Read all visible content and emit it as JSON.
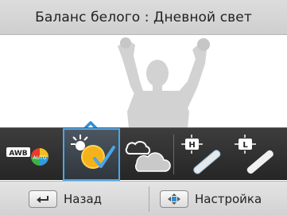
{
  "title": "Баланс белого : Дневной свет",
  "white_balance_options": [
    {
      "icon": "auto-wb-icon",
      "label": "AWB",
      "sublabel": "AUTO",
      "selected": false
    },
    {
      "icon": "daylight-icon",
      "selected": true
    },
    {
      "icon": "cloudy-icon",
      "selected": false
    },
    {
      "icon": "fluorescent-h-icon",
      "label": "H",
      "selected": false
    },
    {
      "icon": "fluorescent-l-icon",
      "label": "L",
      "selected": false
    }
  ],
  "bottom_bar": {
    "back_label": "Назад",
    "settings_label": "Настройка"
  },
  "colors": {
    "selection": "#4aa6e6",
    "title_bar": "#d6d6d6",
    "strip": "#2f2f2f"
  }
}
